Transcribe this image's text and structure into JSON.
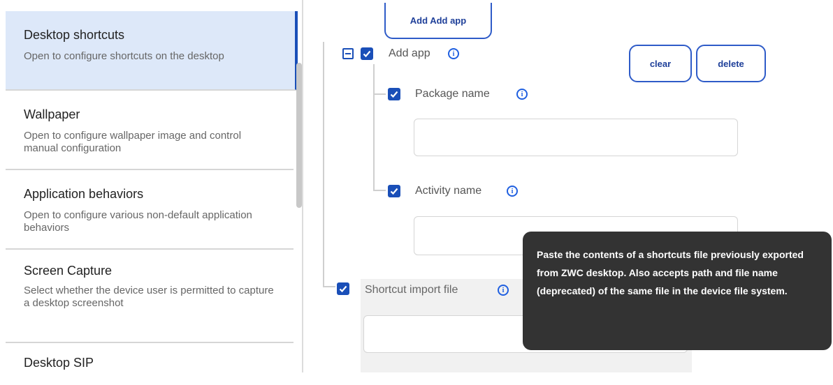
{
  "sidebar": {
    "items": [
      {
        "title": "Desktop shortcuts",
        "desc": "Open to configure shortcuts on the desktop"
      },
      {
        "title": "Wallpaper",
        "desc": "Open to configure wallpaper image and control manual configuration"
      },
      {
        "title": "Application behaviors",
        "desc": "Open to configure various non-default application behaviors"
      },
      {
        "title": "Screen Capture",
        "desc": "Select whether the device user is permitted to capture a desktop screenshot"
      },
      {
        "title": "Desktop SIP",
        "desc": ""
      }
    ]
  },
  "main": {
    "add_button": "Add Add app",
    "add_app_label": "Add app",
    "clear_button": "clear",
    "delete_button": "delete",
    "package_name_label": "Package name",
    "package_name_value": "",
    "activity_name_label": "Activity name",
    "activity_name_value": "",
    "shortcut_import_label": "Shortcut import file",
    "shortcut_import_value": "",
    "tooltip": "Paste the contents of a shortcuts file previously exported from ZWC desktop. Also accepts path and file name (deprecated) of the same file in the device file system."
  },
  "colors": {
    "accent": "#1a4fb8",
    "active_bg": "#dde8f9",
    "tooltip_bg": "#333333"
  },
  "icons": [
    "check-icon",
    "collapse-icon",
    "info-icon"
  ]
}
